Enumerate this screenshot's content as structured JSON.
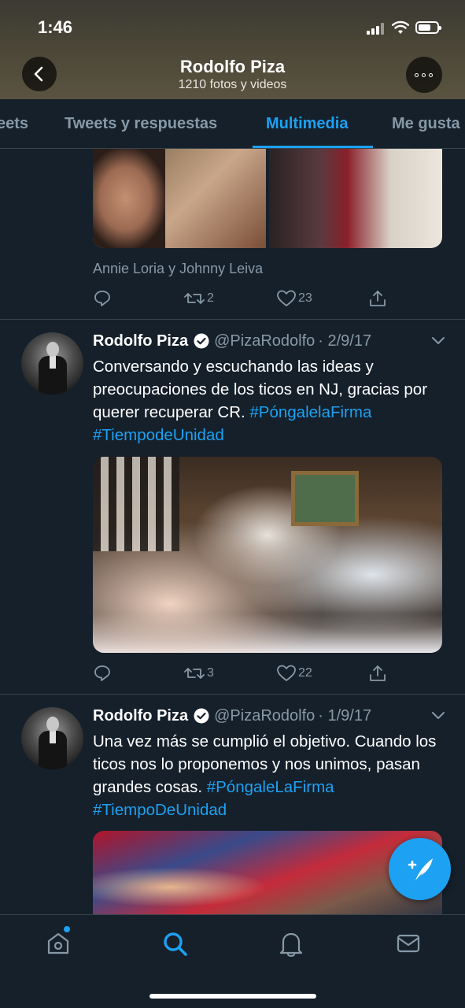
{
  "status_bar": {
    "time": "1:46"
  },
  "header": {
    "title": "Rodolfo Piza",
    "subtitle": "1210 fotos y videos"
  },
  "tabs": [
    {
      "label": "eets"
    },
    {
      "label": "Tweets y respuestas"
    },
    {
      "label": "Multimedia",
      "active": true
    },
    {
      "label": "Me gusta"
    }
  ],
  "tweets": [
    {
      "tagged": "Annie Loria y Johnny Leiva",
      "retweets": "2",
      "likes": "23"
    },
    {
      "name": "Rodolfo Piza",
      "handle": "@PizaRodolfo",
      "date": "· 2/9/17",
      "text": "Conversando y escuchando las ideas y preocupaciones de los ticos en NJ, gracias por querer recuperar CR. ",
      "hashtag1": "#PóngalelaFirma",
      "hashtag2": "#TiempodeUnidad",
      "retweets": "3",
      "likes": "22"
    },
    {
      "name": "Rodolfo Piza",
      "handle": "@PizaRodolfo",
      "date": "· 1/9/17",
      "text": "Una vez más se cumplió el objetivo. Cuando los ticos nos lo proponemos y nos unimos, pasan grandes cosas. ",
      "hashtag1": "#PóngaleLaFirma",
      "hashtag2": "#TiempoDeUnidad"
    }
  ],
  "colors": {
    "background": "#15202b",
    "accent": "#1da1f2",
    "secondary_text": "#8899a6",
    "divider": "#38444d"
  },
  "icons": {
    "back": "chevron-left-icon",
    "more": "more-dots-icon",
    "reply": "reply-icon",
    "retweet": "retweet-icon",
    "like": "heart-icon",
    "share": "share-icon",
    "verified": "verified-badge-icon",
    "compose": "compose-icon",
    "nav": [
      "home-icon",
      "search-icon",
      "notifications-icon",
      "messages-icon"
    ]
  }
}
